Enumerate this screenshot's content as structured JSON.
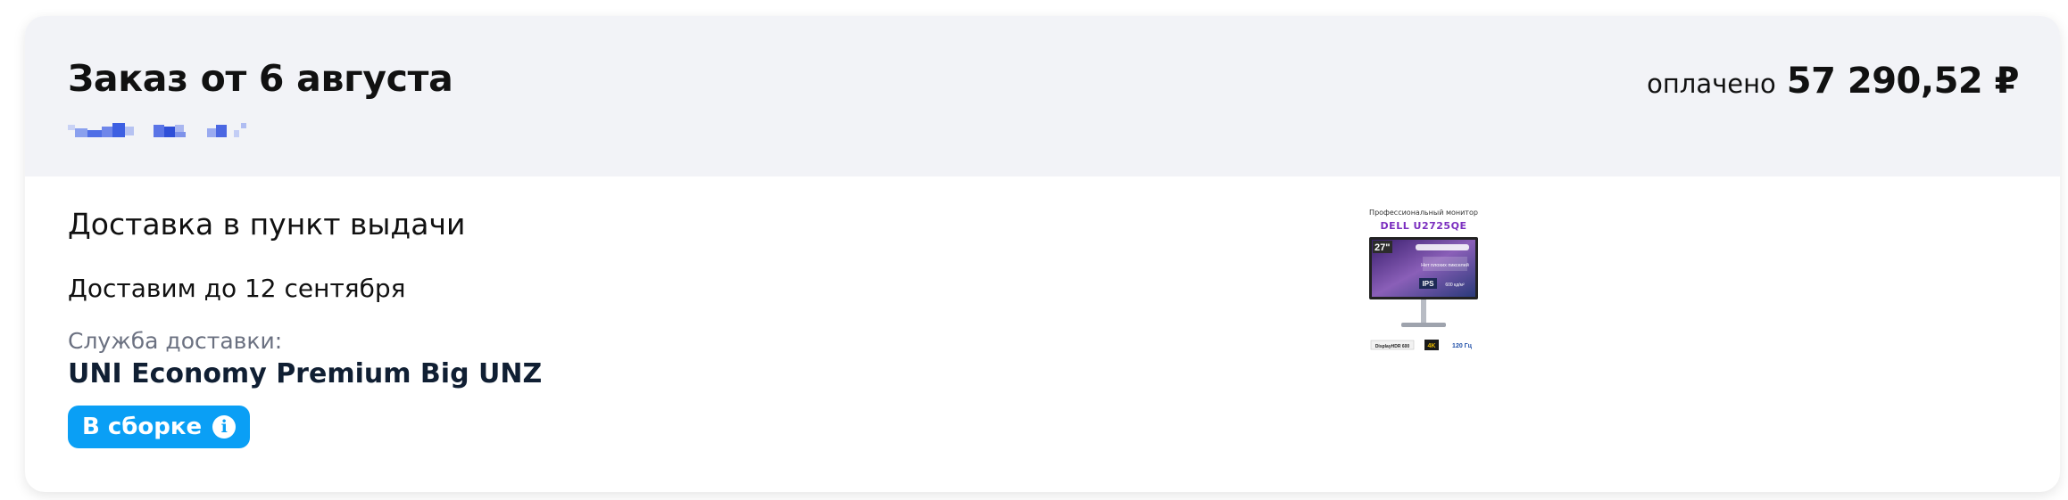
{
  "order": {
    "title": "Заказ от 6 августа",
    "paid_label": "оплачено",
    "paid_amount": "57 290,52 ₽"
  },
  "delivery": {
    "type_label": "Доставка в пункт выдачи",
    "date_text": "Доставим до 12 сентября",
    "service_label": "Служба доставки:",
    "service_name": "UNI Economy Premium Big UNZ"
  },
  "status": {
    "label": "В сборке",
    "color": "#0a9ff5",
    "icon": "info-icon"
  },
  "product_thumbnail": {
    "subtitle": "Профессиональный монитор",
    "model": "DELL U2725QE",
    "size_badge": "27\"",
    "feature_text": "Нет плохих пикселей",
    "panel_badge": "IPS",
    "brightness": "600 кд/м²",
    "hdr_badge": "DisplayHDR 600",
    "resolution_badge": "4K",
    "refresh_badge": "120 Гц"
  },
  "colors": {
    "header_bg": "#f2f3f7",
    "accent": "#0a9ff5",
    "secondary_text": "#6b7181"
  }
}
